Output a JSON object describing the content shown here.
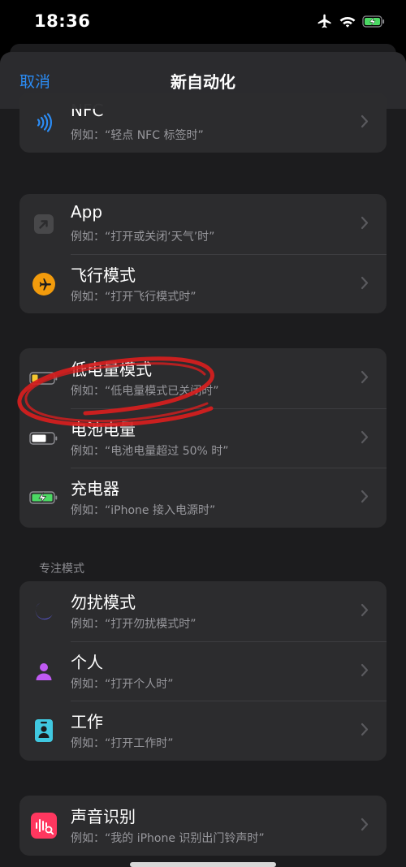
{
  "status_bar": {
    "time": "18:36"
  },
  "nav": {
    "cancel": "取消",
    "title": "新自动化"
  },
  "groups": {
    "g0": [
      {
        "title": "NFC",
        "subtitle": "例如：“轻点 NFC 标签时”",
        "icon": "nfc-icon"
      }
    ],
    "g1": [
      {
        "title": "App",
        "subtitle": "例如：“打开或关闭‘天气’时”",
        "icon": "app-arrow-icon"
      },
      {
        "title": "飞行模式",
        "subtitle": "例如：“打开飞行模式时”",
        "icon": "airplane-icon"
      }
    ],
    "g2": [
      {
        "title": "低电量模式",
        "subtitle": "例如：“低电量模式已关闭时”",
        "icon": "low-battery-icon"
      },
      {
        "title": "电池电量",
        "subtitle": "例如：“电池电量超过 50% 时”",
        "icon": "battery-icon"
      },
      {
        "title": "充电器",
        "subtitle": "例如：“iPhone 接入电源时”",
        "icon": "charging-battery-icon"
      }
    ],
    "focus_header": "专注模式",
    "g3": [
      {
        "title": "勿扰模式",
        "subtitle": "例如：“打开勿扰模式时”",
        "icon": "moon-icon"
      },
      {
        "title": "个人",
        "subtitle": "例如：“打开个人时”",
        "icon": "person-icon"
      },
      {
        "title": "工作",
        "subtitle": "例如：“打开工作时”",
        "icon": "work-badge-icon"
      }
    ],
    "g4": [
      {
        "title": "声音识别",
        "subtitle": "例如：“我的 iPhone 识别出门铃声时”",
        "icon": "sound-recognition-icon"
      }
    ]
  },
  "colors": {
    "accent": "#2b8cf5",
    "airplane": "#f29b0c",
    "low_battery": "#f5c830",
    "charging": "#4cd964",
    "focus_dnd": "#5e5ce6",
    "focus_personal": "#bf5af2",
    "focus_work": "#40c8e0",
    "sound": "#ff375f",
    "annotation": "#d81e1e"
  }
}
